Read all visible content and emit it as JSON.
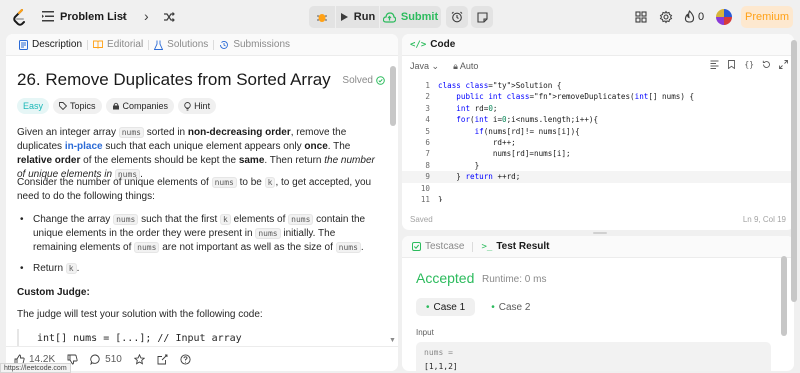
{
  "topbar": {
    "problem_list": "Problem List",
    "run": "Run",
    "submit": "Submit",
    "streak_count": "0",
    "premium": "Premium"
  },
  "left": {
    "tabs": [
      "Description",
      "Editorial",
      "Solutions",
      "Submissions"
    ],
    "title": "26. Remove Duplicates from Sorted Array",
    "solved": "Solved",
    "chips": [
      "Easy",
      "Topics",
      "Companies",
      "Hint"
    ],
    "p1": {
      "a": "Given an integer array ",
      "code_nums": "nums",
      "b": " sorted in ",
      "bold1": "non-decreasing order",
      "c": ", remove the duplicates ",
      "link": "in-place",
      "d": " such that each unique element appears only ",
      "bold2": "once",
      "e": ". The ",
      "bold3": "relative order",
      "f": " of the elements should be kept the ",
      "bold4": "same",
      "g": ". Then return ",
      "ital": "the number of unique elements in",
      "code_nums2": "nums",
      "h": "."
    },
    "p2": {
      "a": "Consider the number of unique elements of ",
      "code_nums": "nums",
      "b": " to be ",
      "code_k": "k",
      "c": ", to get accepted, you need to do the following things:"
    },
    "bullet1": {
      "a": "Change the array ",
      "code_nums": "nums",
      "b": " such that the first ",
      "code_k": "k",
      "c": " elements of ",
      "code_nums2": "nums",
      "d": " contain the unique elements in the order they were present in ",
      "code_nums3": "nums",
      "e": " initially. The remaining elements of ",
      "code_nums4": "nums",
      "f": " are not important as well as the size of ",
      "code_nums5": "nums",
      "g": "."
    },
    "bullet2": {
      "a": "Return ",
      "code_k": "k",
      "b": "."
    },
    "custom_judge": "Custom Judge:",
    "judge_text": "The judge will test your solution with the following code:",
    "code_line": "int[] nums = [...]; // Input array",
    "likes": "14.2K",
    "comments": "510",
    "url_tip": "https://leetcode.com"
  },
  "editor": {
    "header": "Code",
    "language": "Java",
    "auto": "Auto",
    "lines": [
      {
        "n": "1",
        "t": "class Solution {"
      },
      {
        "n": "2",
        "t": "    public int removeDuplicates(int[] nums) {"
      },
      {
        "n": "3",
        "t": "    int rd=0;"
      },
      {
        "n": "4",
        "t": "    for(int i=0;i<nums.length;i++){"
      },
      {
        "n": "5",
        "t": "        if(nums[rd]!= nums[i]){"
      },
      {
        "n": "6",
        "t": "            rd++;"
      },
      {
        "n": "7",
        "t": "            nums[rd]=nums[i];"
      },
      {
        "n": "8",
        "t": "        }"
      },
      {
        "n": "9",
        "t": "    } return ++rd;"
      },
      {
        "n": "10",
        "t": ""
      },
      {
        "n": "11",
        "t": "}"
      }
    ],
    "saved": "Saved",
    "cursor": "Ln 9, Col 19"
  },
  "test": {
    "tab_testcase": "Testcase",
    "tab_result": "Test Result",
    "status": "Accepted",
    "runtime": "Runtime: 0 ms",
    "cases": [
      "Case 1",
      "Case 2"
    ],
    "input_label": "Input",
    "input_var": "nums =",
    "input_value": "[1,1,2]"
  },
  "colors": {
    "accent_green": "#2cbb5d",
    "premium": "#ffa116",
    "link": "#2a6ad6"
  }
}
